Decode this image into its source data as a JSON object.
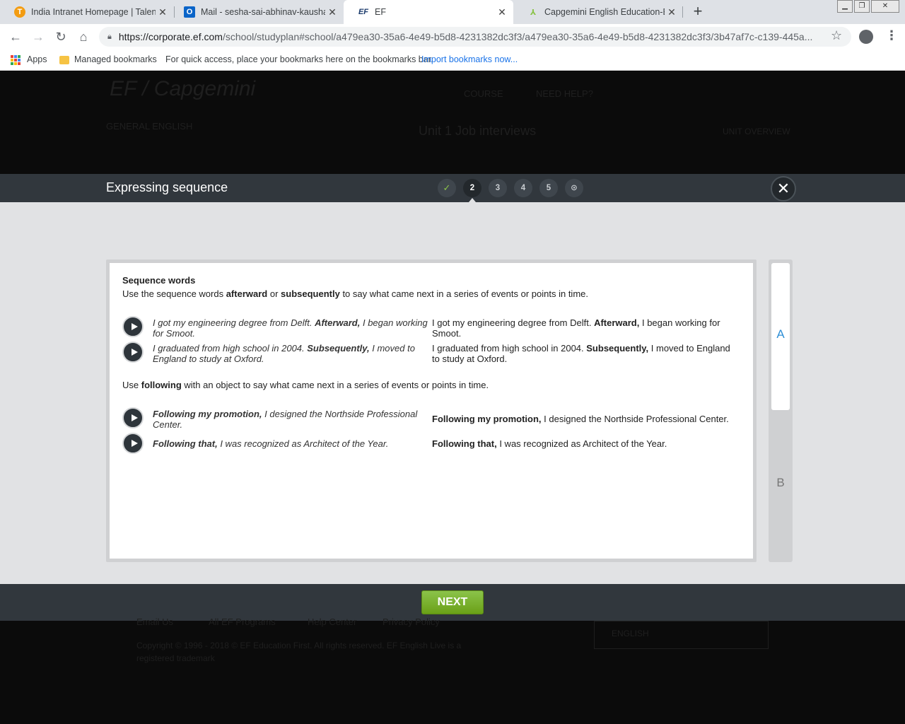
{
  "browser": {
    "tabs": [
      {
        "label": "India Intranet Homepage | Talent",
        "icon": "talent-favicon"
      },
      {
        "label": "Mail - sesha-sai-abhinav-kaushal",
        "icon": "outlook-favicon"
      },
      {
        "label": "EF",
        "icon": "ef-favicon"
      },
      {
        "label": "Capgemini English Education-EF",
        "icon": "capgemini-favicon"
      }
    ],
    "url_host": "https://corporate.ef.com",
    "url_path": "/school/studyplan#school/a479ea30-35a6-4e49-b5d8-4231382dc3f3/a479ea30-35a6-4e49-b5d8-4231382dc3f3/3b47af7c-c139-445a...",
    "bookmarks": {
      "apps": "Apps",
      "managed": "Managed bookmarks",
      "hint": "For quick access, place your bookmarks here on the bookmarks bar.",
      "import": "Import bookmarks now..."
    }
  },
  "background_page": {
    "logo": "EF / Capgemini",
    "nav": [
      "COURSE",
      "NEED HELP?"
    ],
    "course_name": "GENERAL ENGLISH",
    "unit_title": "Unit 1 Job interviews",
    "unit_overview": "UNIT OVERVIEW",
    "footer_links": [
      "Email Us",
      "All EF Programs",
      "Help Center",
      "Privacy Policy"
    ],
    "copyright": "Copyright © 1996 - 2018 © EF Education First. All rights reserved. EF English Live is a registered trademark",
    "language": "ENGLISH"
  },
  "modal": {
    "title": "Expressing sequence",
    "steps": [
      "✓",
      "2",
      "3",
      "4",
      "5",
      "⊙"
    ],
    "close": "✕",
    "heading": "Sequence words",
    "intro": {
      "a": "Use the sequence words ",
      "b": "afterward",
      "c": " or ",
      "d": "subsequently",
      "e": " to say what came next in a series of events or points in time."
    },
    "following_intro": {
      "a": "Use ",
      "b": "following",
      "c": " with an object to say what came next in a series of events or points in time."
    },
    "examples": [
      {
        "pre": "I got my engineering degree from Delft. ",
        "key": "Afterward,",
        "post": " I began working for Smoot."
      },
      {
        "pre": "I graduated from high school in 2004. ",
        "key": "Subsequently,",
        "post": " I moved to England to study at Oxford."
      },
      {
        "pre": "",
        "key": "Following my promotion,",
        "post": " I designed the Northside Professional Center."
      },
      {
        "pre": "",
        "key": "Following that,",
        "post": " I was recognized as Architect of the Year."
      }
    ],
    "side_labels": [
      "A",
      "B"
    ],
    "next": "NEXT"
  }
}
